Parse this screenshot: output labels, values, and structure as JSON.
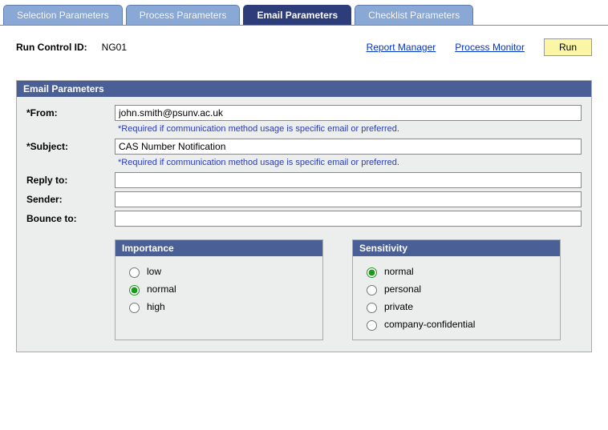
{
  "tabs": {
    "t0": "Selection Parameters",
    "t1": "Process Parameters",
    "t2": "Email Parameters",
    "t3": "Checklist Parameters"
  },
  "topbar": {
    "runControlLabel": "Run Control ID:",
    "runControlValue": "NG01",
    "reportManager": "Report Manager",
    "processMonitor": "Process Monitor",
    "runLabel": "Run"
  },
  "panel": {
    "title": "Email Parameters",
    "fromLabel": "*From:",
    "fromValue": "john.smith@psunv.ac.uk",
    "subjectLabel": "*Subject:",
    "subjectValue": "CAS Number Notification",
    "hint": "*Required if communication method usage is specific email or preferred.",
    "replyToLabel": "Reply to:",
    "replyToValue": "",
    "senderLabel": "Sender:",
    "senderValue": "",
    "bounceToLabel": "Bounce to:",
    "bounceToValue": ""
  },
  "importance": {
    "title": "Importance",
    "low": "low",
    "normal": "normal",
    "high": "high"
  },
  "sensitivity": {
    "title": "Sensitivity",
    "normal": "normal",
    "personal": "personal",
    "private": "private",
    "confidential": "company-confidential"
  }
}
